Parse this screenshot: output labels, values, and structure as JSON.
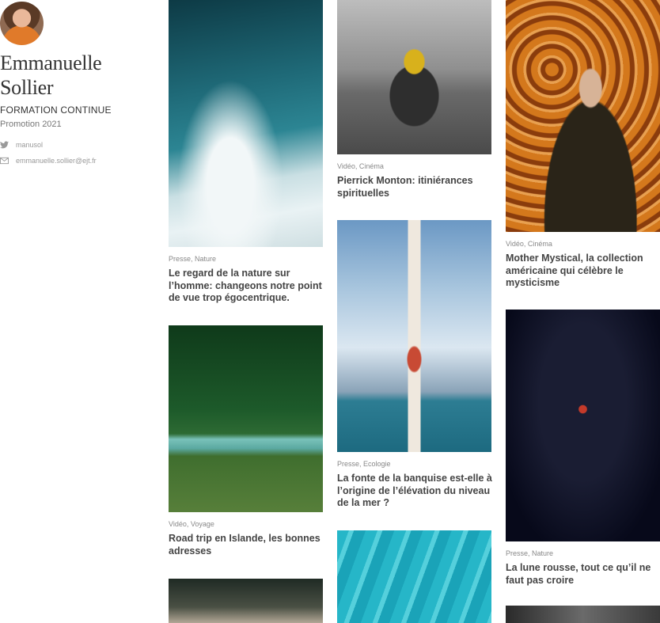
{
  "profile": {
    "name": "Emmanuelle Sollier",
    "formation": "FORMATION CONTINUE",
    "promotion": "Promotion 2021",
    "twitter": "manusol",
    "email": "emmanuelle.sollier@ejt.fr"
  },
  "articles": [
    {
      "category": "Presse, Nature",
      "title": "Le regard de la nature sur l’homme: changeons notre point de vue trop égocentrique."
    },
    {
      "category": "Vidéo, Cinéma",
      "title": "Pierrick Monton: itiniérances spirituelles"
    },
    {
      "category": "Vidéo, Cinéma",
      "title": "Mother Mystical, la collection américaine qui célèbre le mysticisme"
    },
    {
      "category": "Vidéo, Voyage",
      "title": "Road trip en Islande, les bonnes adresses"
    },
    {
      "category": "Presse, Ecologie",
      "title": "La fonte de la banquise est-elle à l’origine de l’élévation du niveau de la mer ?"
    },
    {
      "category": "Presse, Nature",
      "title": "La lune rousse, tout ce qu’il ne faut pas croire"
    }
  ],
  "icons": {
    "twitter": "twitter-icon",
    "email": "mail-icon"
  }
}
